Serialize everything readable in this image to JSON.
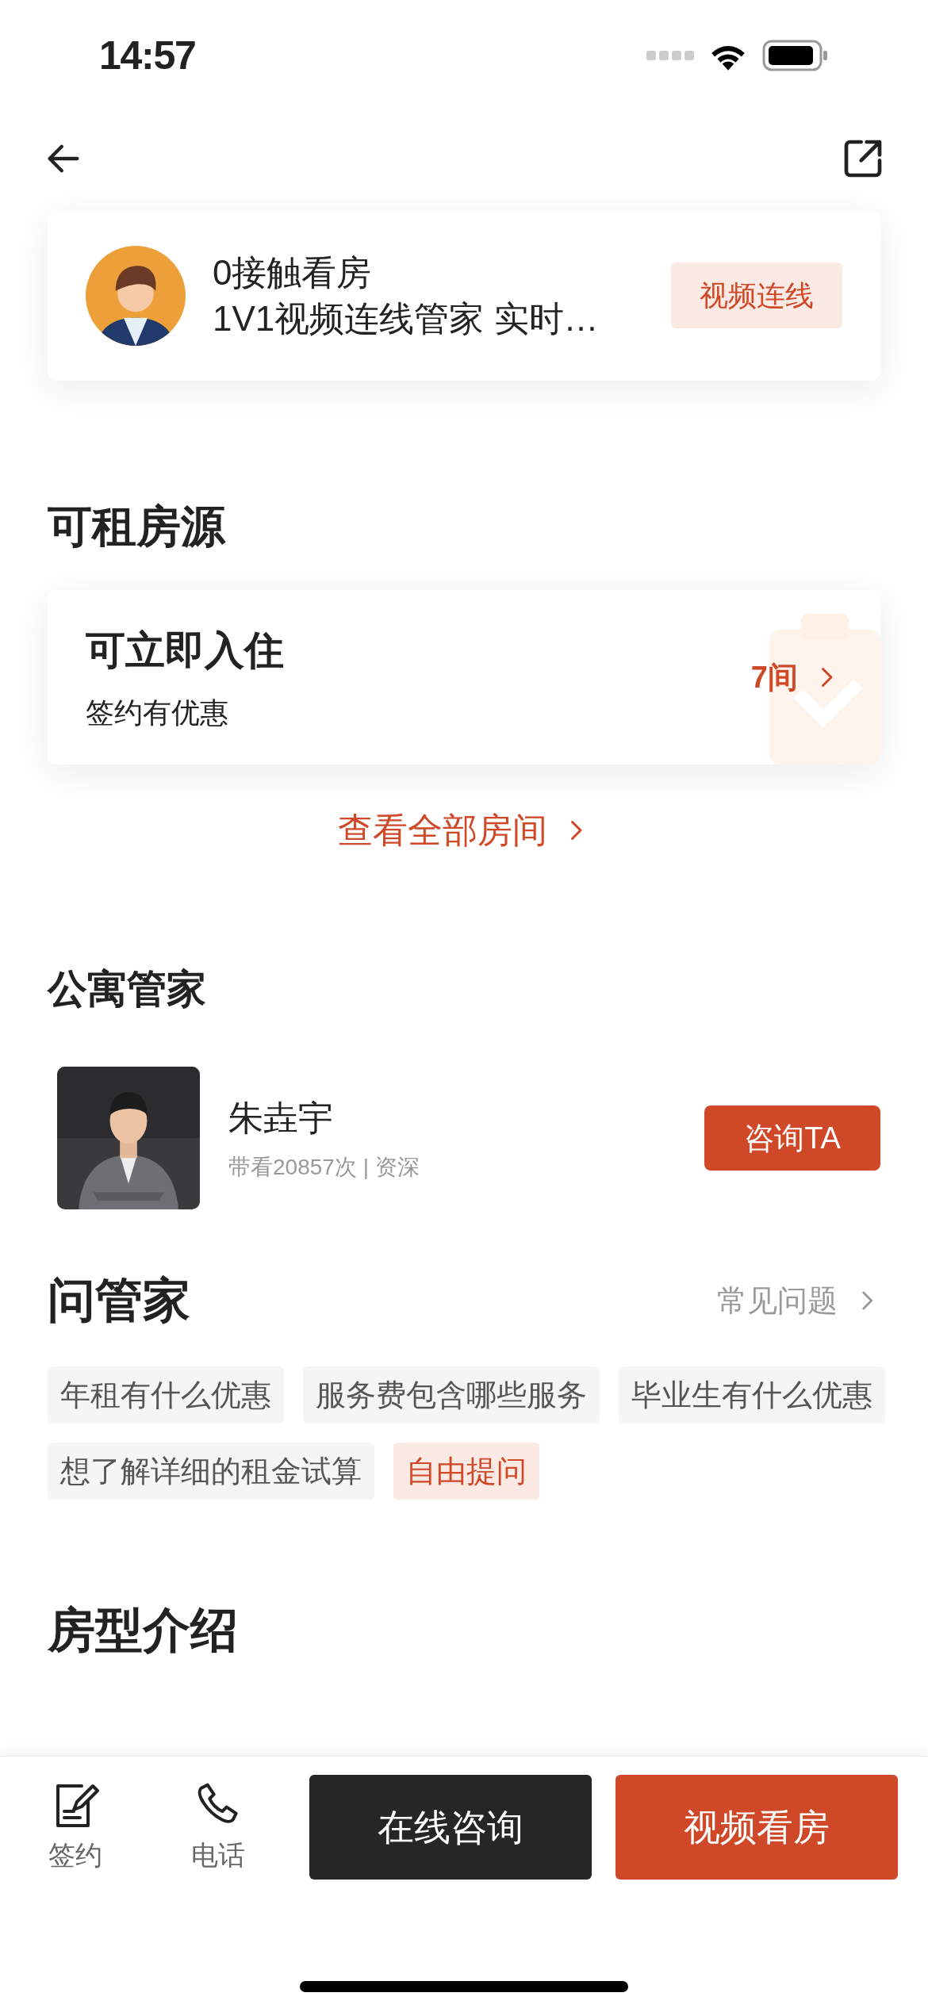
{
  "status_bar": {
    "time": "14:57"
  },
  "promo_card": {
    "title": "0接触看房",
    "subtitle": "1V1视频连线管家 实时…",
    "button": "视频连线"
  },
  "rooms_section": {
    "title": "可租房源",
    "card": {
      "title": "可立即入住",
      "subtitle": "签约有优惠",
      "count": "7间"
    },
    "view_all": "查看全部房间"
  },
  "manager_section": {
    "title": "公寓管家",
    "manager": {
      "name": "朱垚宇",
      "stats": "带看20857次 | 资深",
      "button": "咨询TA"
    }
  },
  "ask_section": {
    "title": "问管家",
    "faq_link": "常见问题",
    "tags": [
      {
        "label": "年租有什么优惠",
        "kind": "question"
      },
      {
        "label": "服务费包含哪些服务",
        "kind": "question"
      },
      {
        "label": "毕业生有什么优惠",
        "kind": "question"
      },
      {
        "label": "想了解详细的租金试算",
        "kind": "question"
      },
      {
        "label": "自由提问",
        "kind": "free"
      }
    ]
  },
  "layout_section": {
    "title": "房型介绍"
  },
  "bottom_bar": {
    "actions": [
      {
        "label": "签约",
        "kind": "sign"
      },
      {
        "label": "电话",
        "kind": "phone"
      }
    ],
    "buttons": [
      {
        "label": "在线咨询",
        "kind": "dark"
      },
      {
        "label": "视频看房",
        "kind": "primary"
      }
    ]
  }
}
